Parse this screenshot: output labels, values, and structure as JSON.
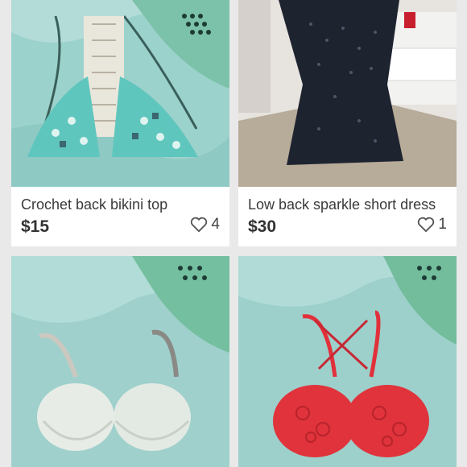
{
  "listings": [
    {
      "title": "Crochet back bikini top",
      "price": "$15",
      "likes": "4",
      "image": "bikini-top-photo"
    },
    {
      "title": "Low back sparkle short dress",
      "price": "$30",
      "likes": "1",
      "image": "sparkle-dress-photo"
    },
    {
      "title": "",
      "price": "",
      "likes": "",
      "image": "white-bra-photo"
    },
    {
      "title": "",
      "price": "",
      "likes": "",
      "image": "red-lace-bra-photo"
    }
  ],
  "icons": {
    "like": "heart-outline-icon"
  }
}
